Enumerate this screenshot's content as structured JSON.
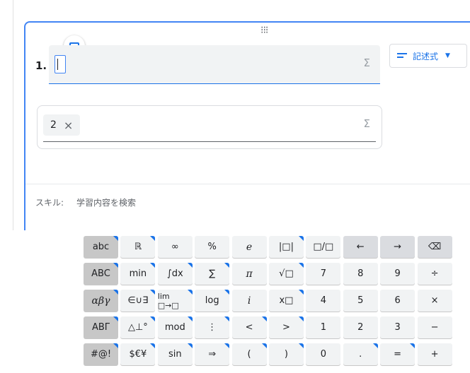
{
  "question": {
    "number": "1.",
    "answer_chip": "2",
    "sigma": "Σ",
    "chip_remove": "×"
  },
  "format_button": {
    "label": "記述式",
    "caret": "▼"
  },
  "skill": {
    "label": "スキル:",
    "search_placeholder": "学習内容を検索"
  },
  "drag_handle": "∴∵",
  "keyboard": {
    "keys": [
      {
        "label": "abc",
        "style": "dark",
        "corner": true,
        "italic": false
      },
      {
        "label": "ℝ",
        "style": "",
        "corner": true,
        "italic": false
      },
      {
        "label": "∞",
        "style": "",
        "corner": false,
        "italic": false
      },
      {
        "label": "%",
        "style": "",
        "corner": false,
        "italic": false
      },
      {
        "label": "e",
        "style": "",
        "corner": false,
        "italic": true
      },
      {
        "label": "|□|",
        "style": "",
        "corner": true,
        "italic": false
      },
      {
        "label": "□/□",
        "style": "",
        "corner": false,
        "italic": false
      },
      {
        "label": "←",
        "style": "mid",
        "corner": false,
        "italic": false
      },
      {
        "label": "→",
        "style": "mid",
        "corner": false,
        "italic": false
      },
      {
        "label": "⌫",
        "style": "mid",
        "corner": false,
        "italic": false
      },
      {
        "label": "ABC",
        "style": "dark",
        "corner": true,
        "italic": false
      },
      {
        "label": "min",
        "style": "",
        "corner": true,
        "italic": false
      },
      {
        "label": "∫dx",
        "style": "",
        "corner": true,
        "italic": false
      },
      {
        "label": "∑",
        "style": "",
        "corner": true,
        "italic": false
      },
      {
        "label": "π",
        "style": "",
        "corner": false,
        "italic": true
      },
      {
        "label": "√□",
        "style": "",
        "corner": true,
        "italic": false
      },
      {
        "label": "7",
        "style": "",
        "corner": false,
        "italic": false
      },
      {
        "label": "8",
        "style": "",
        "corner": false,
        "italic": false
      },
      {
        "label": "9",
        "style": "",
        "corner": false,
        "italic": false
      },
      {
        "label": "÷",
        "style": "",
        "corner": false,
        "italic": false
      },
      {
        "label": "αβγ",
        "style": "dark",
        "corner": true,
        "italic": true
      },
      {
        "label": "∈∪∃",
        "style": "",
        "corner": true,
        "italic": false
      },
      {
        "label": "lim □→□",
        "style": "",
        "corner": true,
        "italic": false
      },
      {
        "label": "log",
        "style": "",
        "corner": true,
        "italic": false
      },
      {
        "label": "i",
        "style": "",
        "corner": false,
        "italic": true
      },
      {
        "label": "x□",
        "style": "",
        "corner": true,
        "italic": false
      },
      {
        "label": "4",
        "style": "",
        "corner": false,
        "italic": false
      },
      {
        "label": "5",
        "style": "",
        "corner": false,
        "italic": false
      },
      {
        "label": "6",
        "style": "",
        "corner": false,
        "italic": false
      },
      {
        "label": "×",
        "style": "",
        "corner": false,
        "italic": false
      },
      {
        "label": "ΑΒΓ",
        "style": "dark",
        "corner": true,
        "italic": false
      },
      {
        "label": "△⊥°",
        "style": "",
        "corner": true,
        "italic": false
      },
      {
        "label": "mod",
        "style": "",
        "corner": true,
        "italic": false
      },
      {
        "label": "⋮",
        "style": "",
        "corner": true,
        "italic": false
      },
      {
        "label": "<",
        "style": "",
        "corner": true,
        "italic": false
      },
      {
        "label": ">",
        "style": "",
        "corner": true,
        "italic": false
      },
      {
        "label": "1",
        "style": "",
        "corner": false,
        "italic": false
      },
      {
        "label": "2",
        "style": "",
        "corner": false,
        "italic": false
      },
      {
        "label": "3",
        "style": "",
        "corner": false,
        "italic": false
      },
      {
        "label": "−",
        "style": "",
        "corner": false,
        "italic": false
      },
      {
        "label": "#@!",
        "style": "dark",
        "corner": true,
        "italic": false
      },
      {
        "label": "$€¥",
        "style": "",
        "corner": true,
        "italic": false
      },
      {
        "label": "sin",
        "style": "",
        "corner": true,
        "italic": false
      },
      {
        "label": "⇒",
        "style": "",
        "corner": true,
        "italic": false
      },
      {
        "label": "(",
        "style": "",
        "corner": true,
        "italic": false
      },
      {
        "label": ")",
        "style": "",
        "corner": true,
        "italic": false
      },
      {
        "label": "0",
        "style": "",
        "corner": false,
        "italic": false
      },
      {
        "label": ".",
        "style": "",
        "corner": true,
        "italic": false
      },
      {
        "label": "=",
        "style": "",
        "corner": true,
        "italic": false
      },
      {
        "label": "+",
        "style": "",
        "corner": false,
        "italic": false
      }
    ]
  },
  "colors": {
    "accent": "#1a73e8",
    "key_bg": "#f1f3f4",
    "key_dark": "#c7c7c7"
  }
}
